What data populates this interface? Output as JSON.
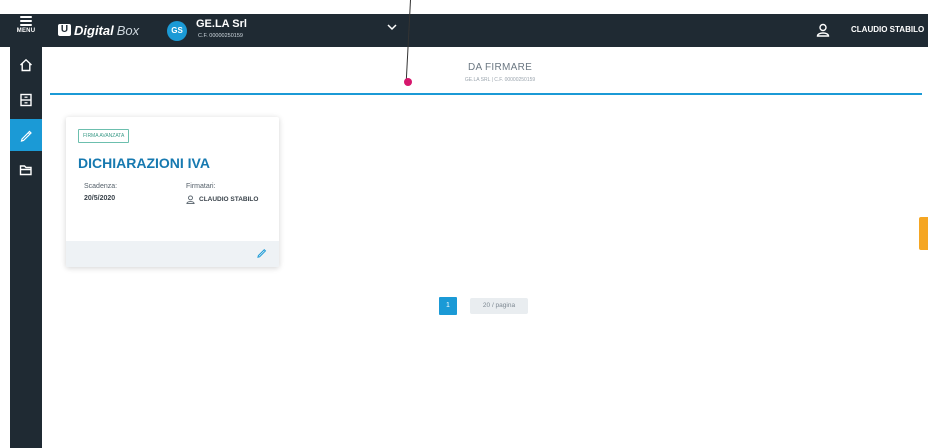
{
  "topbar": {
    "menu_label": "MENU",
    "brand_name": "Digital",
    "brand_suffix": "Box",
    "company_initials": "GS",
    "company_name": "GE.LA Srl",
    "company_cf": "C.F. 00000250159",
    "user_name": "CLAUDIO STABILO"
  },
  "sidebar": {
    "items": [
      {
        "icon": "home-icon",
        "active": false
      },
      {
        "icon": "archive-icon",
        "active": false
      },
      {
        "icon": "pen-icon",
        "active": true
      },
      {
        "icon": "folder-icon",
        "active": false
      }
    ]
  },
  "header": {
    "title": "DA FIRMARE",
    "subtitle": "GE.LA SRL | C.F. 00000250159"
  },
  "card": {
    "badge": "FIRMA AVANZATA",
    "title": "DICHIARAZIONI IVA",
    "deadline_label": "Scadenza:",
    "deadline_value": "20/5/2020",
    "signers_label": "Firmatari:",
    "signer_name": "CLAUDIO STABILO"
  },
  "pagination": {
    "current_page": "1",
    "per_page": "20 / pagina"
  },
  "colors": {
    "topbar": "#1f2a33",
    "accent": "#1b9ad6",
    "title": "#1679b0",
    "callout": "#d6176d",
    "side_tab": "#f5a623"
  }
}
